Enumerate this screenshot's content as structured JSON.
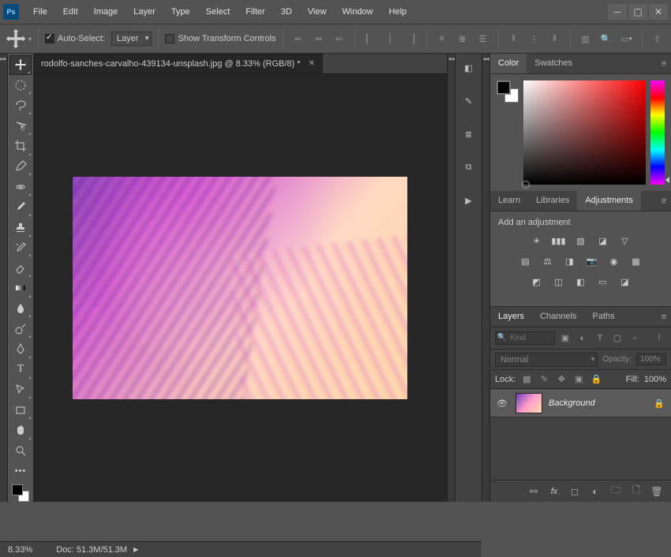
{
  "app": {
    "logo": "Ps"
  },
  "menu": [
    "File",
    "Edit",
    "Image",
    "Layer",
    "Type",
    "Select",
    "Filter",
    "3D",
    "View",
    "Window",
    "Help"
  ],
  "optbar": {
    "auto_select": "Auto-Select:",
    "layer_select": "Layer",
    "show_transform": "Show Transform Controls"
  },
  "doc": {
    "tab_title": "rodolfo-sanches-carvalho-439134-unsplash.jpg @ 8.33% (RGB/8) *"
  },
  "panels": {
    "color_tabs": [
      "Color",
      "Swatches"
    ],
    "adj_tabs": [
      "Learn",
      "Libraries",
      "Adjustments"
    ],
    "adj_title": "Add an adjustment",
    "layer_tabs": [
      "Layers",
      "Channels",
      "Paths"
    ]
  },
  "layers": {
    "kind_placeholder": "Kind",
    "blend_mode": "Normal",
    "opacity_label": "Opacity:",
    "opacity_value": "100%",
    "lock_label": "Lock:",
    "fill_label": "Fill:",
    "fill_value": "100%",
    "items": [
      {
        "name": "Background"
      }
    ]
  },
  "status": {
    "zoom": "8.33%",
    "doc_size": "Doc: 51.3M/51.3M"
  }
}
